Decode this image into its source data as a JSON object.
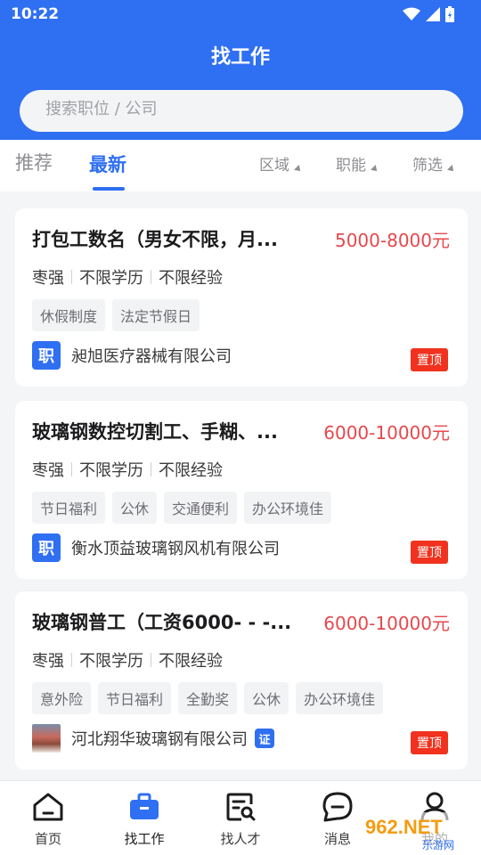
{
  "status_bar": {
    "time": "10:22"
  },
  "header": {
    "title": "找工作"
  },
  "search": {
    "placeholder": "搜索职位 / 公司"
  },
  "tabs": [
    {
      "label": "推荐",
      "active": false
    },
    {
      "label": "最新",
      "active": true
    }
  ],
  "filters": [
    {
      "label": "区域"
    },
    {
      "label": "职能"
    },
    {
      "label": "筛选"
    }
  ],
  "jobs": [
    {
      "title": "打包工数名（男女不限，月...",
      "salary": "5000-8000元",
      "location": "枣强",
      "education": "不限学历",
      "experience": "不限经验",
      "tags": [
        "休假制度",
        "法定节假日"
      ],
      "company_logo_text": "职",
      "company": "昶旭医疗器械有限公司",
      "badge": "置顶"
    },
    {
      "title": "玻璃钢数控切割工、手糊、...",
      "salary": "6000-10000元",
      "location": "枣强",
      "education": "不限学历",
      "experience": "不限经验",
      "tags": [
        "节日福利",
        "公休",
        "交通便利",
        "办公环境佳"
      ],
      "company_logo_text": "职",
      "company": "衡水顶益玻璃钢风机有限公司",
      "badge": "置顶"
    },
    {
      "title": "玻璃钢普工（工资6000- - -...",
      "salary": "6000-10000元",
      "location": "枣强",
      "education": "不限学历",
      "experience": "不限经验",
      "tags": [
        "意外险",
        "节日福利",
        "全勤奖",
        "公休",
        "办公环境佳"
      ],
      "company": "河北翔华玻璃钢有限公司",
      "verified_label": "证",
      "badge": "置顶"
    }
  ],
  "bottom_nav": [
    {
      "label": "首页",
      "icon": "home-icon"
    },
    {
      "label": "找工作",
      "icon": "briefcase-icon",
      "active": true
    },
    {
      "label": "找人才",
      "icon": "resume-search-icon"
    },
    {
      "label": "消息",
      "icon": "message-icon"
    },
    {
      "label": "我的",
      "icon": "profile-icon"
    }
  ],
  "watermark": {
    "text": "962.NET",
    "subtext": "乐游网"
  },
  "colors": {
    "primary": "#2f6ff2",
    "salary": "#e5484d",
    "pin": "#f0321e"
  }
}
